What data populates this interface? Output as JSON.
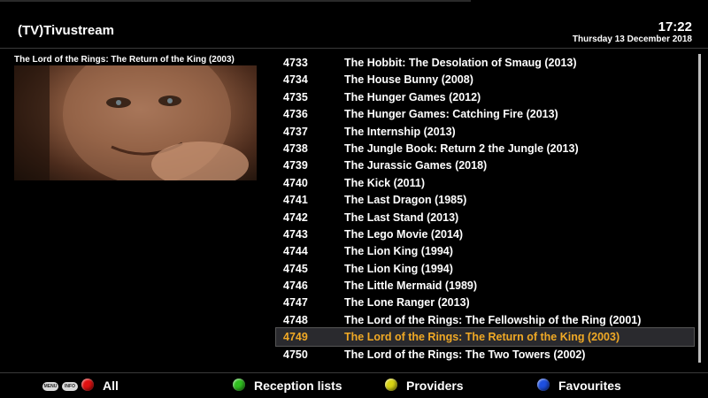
{
  "header": {
    "channel": "(TV)Tivustream",
    "time": "17:22",
    "date": "Thursday 13 December 2018"
  },
  "preview": {
    "title": "The Lord of the Rings: The Return of the King (2003)"
  },
  "list": {
    "rows": [
      {
        "num": "4733",
        "title": "The Hobbit: The Desolation of Smaug (2013)"
      },
      {
        "num": "4734",
        "title": "The House Bunny (2008)"
      },
      {
        "num": "4735",
        "title": "The Hunger Games (2012)"
      },
      {
        "num": "4736",
        "title": "The Hunger Games: Catching Fire (2013)"
      },
      {
        "num": "4737",
        "title": "The Internship (2013)"
      },
      {
        "num": "4738",
        "title": "The Jungle Book: Return 2 the Jungle (2013)"
      },
      {
        "num": "4739",
        "title": "The Jurassic Games (2018)"
      },
      {
        "num": "4740",
        "title": "The Kick (2011)"
      },
      {
        "num": "4741",
        "title": "The Last Dragon (1985)"
      },
      {
        "num": "4742",
        "title": "The Last Stand (2013)"
      },
      {
        "num": "4743",
        "title": "The Lego Movie (2014)"
      },
      {
        "num": "4744",
        "title": "The Lion King (1994)"
      },
      {
        "num": "4745",
        "title": "The Lion King (1994)"
      },
      {
        "num": "4746",
        "title": "The Little Mermaid (1989)"
      },
      {
        "num": "4747",
        "title": "The Lone Ranger (2013)"
      },
      {
        "num": "4748",
        "title": "The Lord of the Rings: The Fellowship of the Ring (2001)"
      },
      {
        "num": "4749",
        "title": "The Lord of the Rings: The Return of the King (2003)"
      },
      {
        "num": "4750",
        "title": "The Lord of the Rings: The Two Towers (2002)"
      }
    ],
    "selected_num": "4749",
    "selected_color": "#f0a925"
  },
  "footer": {
    "menu_badge": "MENU",
    "info_badge": "INFO",
    "red_label": "All",
    "green_label": "Reception lists",
    "yellow_label": "Providers",
    "blue_label": "Favourites",
    "red_color": "#e01010",
    "green_color": "#2fbf1f",
    "yellow_color": "#d8d414",
    "blue_color": "#1d4fe0"
  }
}
